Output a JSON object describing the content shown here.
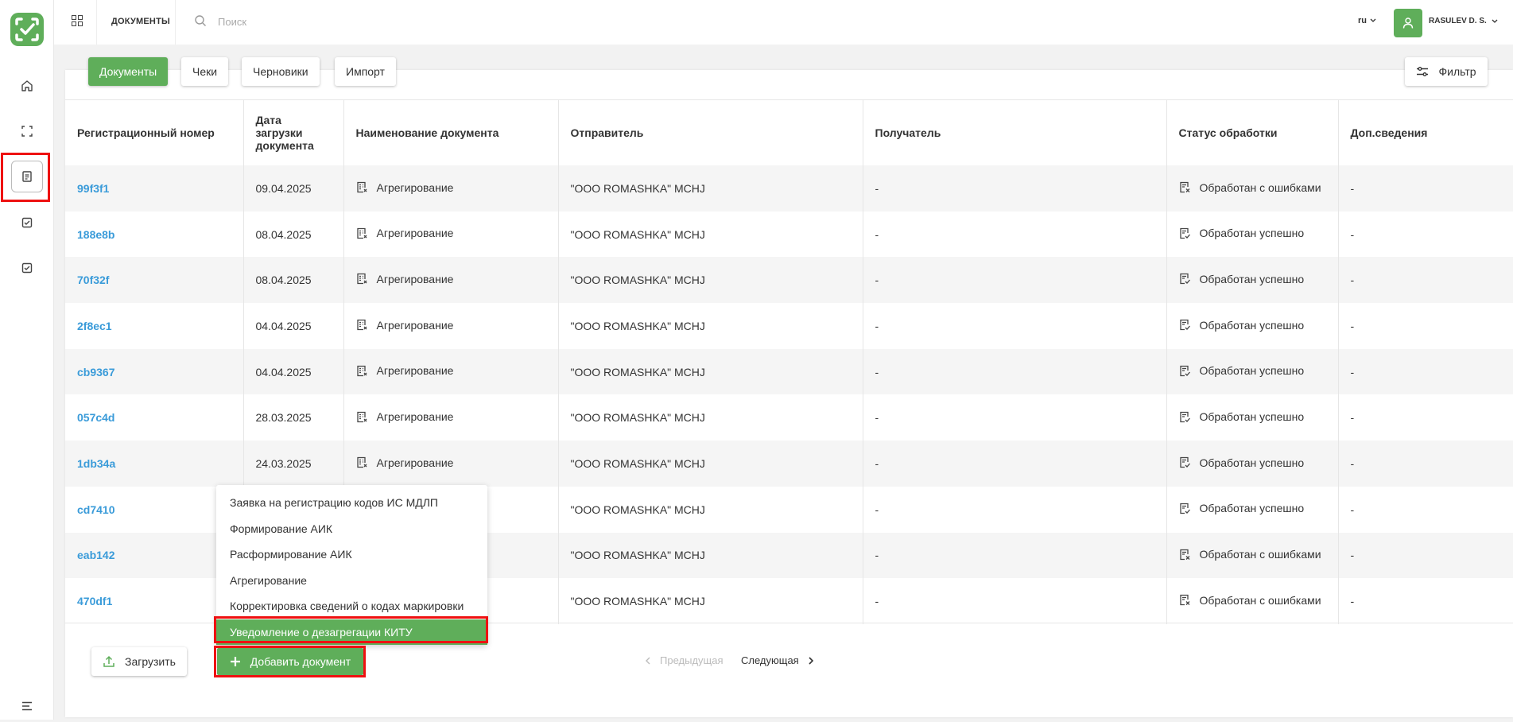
{
  "header": {
    "breadcrumb": "ДОКУМЕНТЫ",
    "search_placeholder": "Поиск",
    "language": "ru",
    "username": "RASULEV D. S."
  },
  "sidebar": {
    "items": [
      {
        "icon": "home-icon"
      },
      {
        "icon": "scan-icon"
      },
      {
        "icon": "document-icon",
        "active": true
      },
      {
        "icon": "checklist-icon"
      },
      {
        "icon": "checklist-icon"
      }
    ]
  },
  "tabs": [
    {
      "label": "Документы",
      "active": true
    },
    {
      "label": "Чеки"
    },
    {
      "label": "Черновики"
    },
    {
      "label": "Импорт"
    }
  ],
  "filter_label": "Фильтр",
  "table": {
    "columns": [
      "Регистрационный номер",
      "Дата загрузки документа",
      "Наименование документа",
      "Отправитель",
      "Получатель",
      "Статус обработки",
      "Доп.сведения"
    ],
    "rows": [
      {
        "reg": "99f3f1",
        "date": "09.04.2025",
        "name": "Агрегирование",
        "sender": "\"ООО ROMASHKA\" MCHJ",
        "receiver": "-",
        "status": "Обработан с ошибками",
        "extra": "-"
      },
      {
        "reg": "188e8b",
        "date": "08.04.2025",
        "name": "Агрегирование",
        "sender": "\"ООО ROMASHKA\" MCHJ",
        "receiver": "-",
        "status": "Обработан успешно",
        "extra": "-"
      },
      {
        "reg": "70f32f",
        "date": "08.04.2025",
        "name": "Агрегирование",
        "sender": "\"ООО ROMASHKA\" MCHJ",
        "receiver": "-",
        "status": "Обработан успешно",
        "extra": "-"
      },
      {
        "reg": "2f8ec1",
        "date": "04.04.2025",
        "name": "Агрегирование",
        "sender": "\"ООО ROMASHKA\" MCHJ",
        "receiver": "-",
        "status": "Обработан успешно",
        "extra": "-"
      },
      {
        "reg": "cb9367",
        "date": "04.04.2025",
        "name": "Агрегирование",
        "sender": "\"ООО ROMASHKA\" MCHJ",
        "receiver": "-",
        "status": "Обработан успешно",
        "extra": "-"
      },
      {
        "reg": "057c4d",
        "date": "28.03.2025",
        "name": "Агрегирование",
        "sender": "\"ООО ROMASHKA\" MCHJ",
        "receiver": "-",
        "status": "Обработан успешно",
        "extra": "-"
      },
      {
        "reg": "1db34a",
        "date": "24.03.2025",
        "name": "Агрегирование",
        "sender": "\"ООО ROMASHKA\" MCHJ",
        "receiver": "-",
        "status": "Обработан успешно",
        "extra": "-"
      },
      {
        "reg": "cd7410",
        "date": "",
        "name": "",
        "sender": "\"ООО ROMASHKA\" MCHJ",
        "receiver": "-",
        "status": "Обработан успешно",
        "extra": "-"
      },
      {
        "reg": "eab142",
        "date": "",
        "name": "",
        "sender": "\"ООО ROMASHKA\" MCHJ",
        "receiver": "-",
        "status": "Обработан с ошибками",
        "extra": "-"
      },
      {
        "reg": "470df1",
        "date": "",
        "name": "",
        "sender": "\"ООО ROMASHKA\" MCHJ",
        "receiver": "-",
        "status": "Обработан с ошибками",
        "extra": "-"
      }
    ]
  },
  "dropdown": {
    "items": [
      "Заявка на регистрацию кодов ИС МДЛП",
      "Формирование АИК",
      "Расформирование АИК",
      "Агрегирование",
      "Корректировка сведений о кодах маркировки",
      "Уведомление о дезагрегации КИТУ"
    ],
    "highlighted_index": 5
  },
  "footer": {
    "upload_label": "Загрузить",
    "add_label": "Добавить документ",
    "prev_label": "Предыдущая",
    "next_label": "Следующая"
  },
  "colors": {
    "accent": "#5fae5a",
    "link": "#3a9bd9",
    "highlight_border": "#e11111"
  }
}
